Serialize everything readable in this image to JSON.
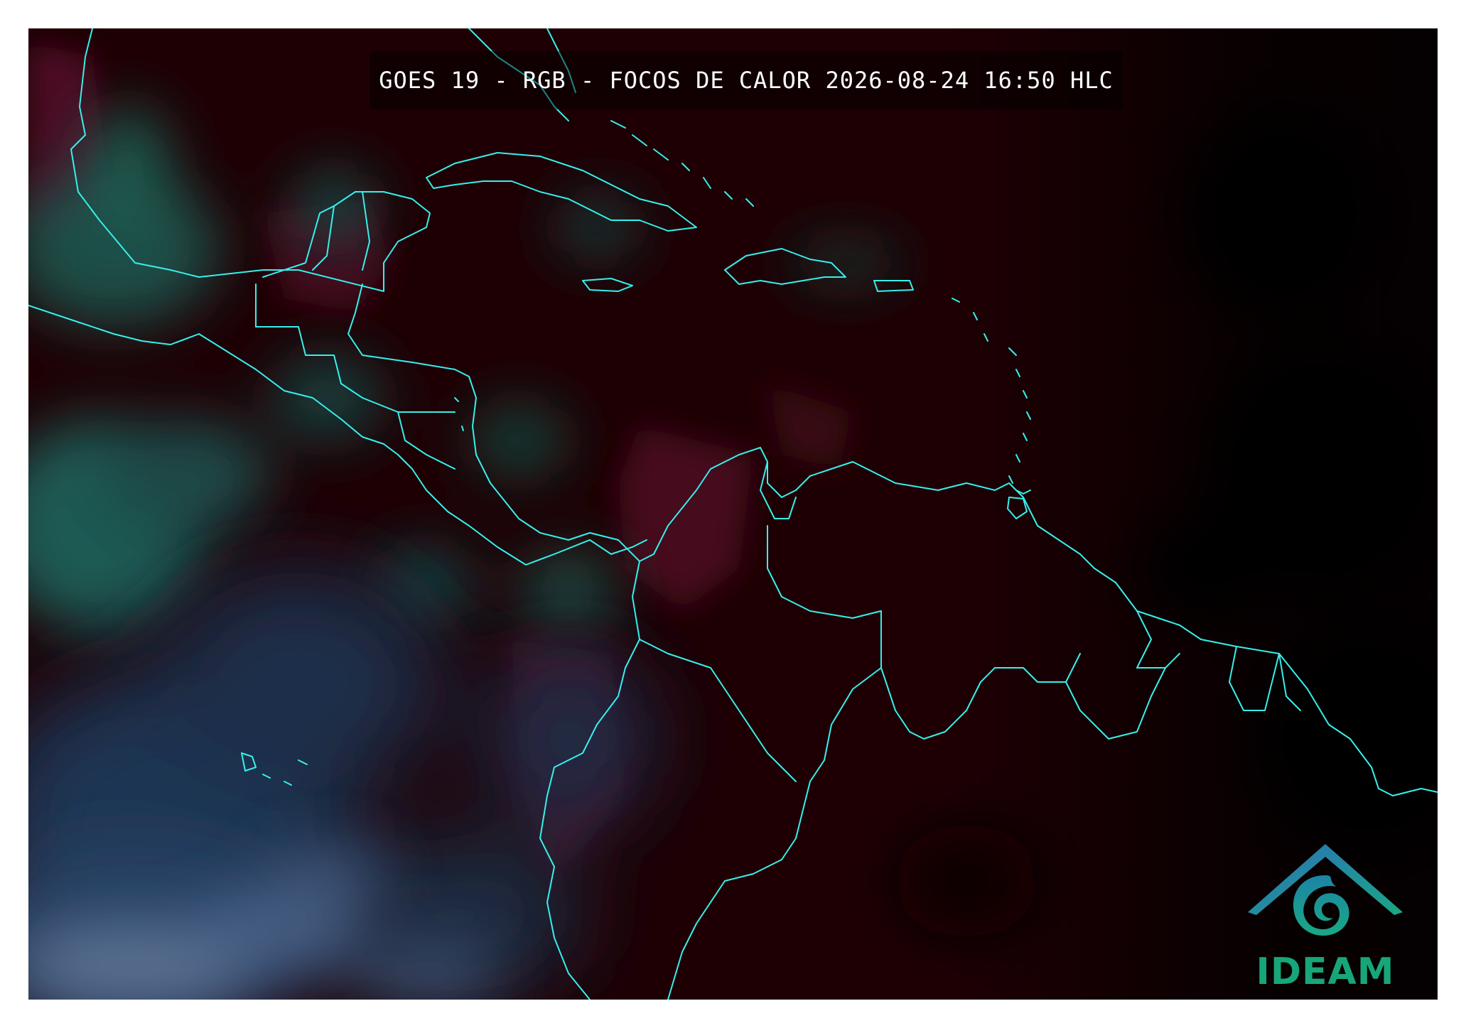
{
  "map": {
    "title": "GOES 19 - RGB - FOCOS DE CALOR 2026-08-24 16:50 HLC",
    "colors": {
      "background": "#1e0004",
      "land_red": "#4a0a1e",
      "cloud_teal": "#1b4d46",
      "cloud_blue": "#1c3552",
      "high_cloud": "#5f7596",
      "night_dark": "#050202",
      "borders": "#36f0ec"
    }
  },
  "logo": {
    "text": "IDEAM",
    "colors": {
      "roof": "#2c6fb8",
      "swirl": "#1aa884",
      "text": "#17a67a"
    }
  }
}
